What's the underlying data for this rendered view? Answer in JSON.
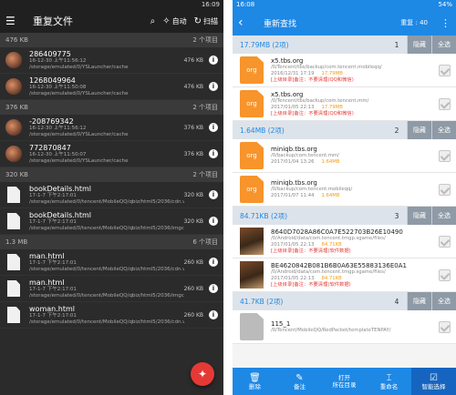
{
  "left": {
    "status_time": "16:09",
    "title": "重复文件",
    "auto_label": "自动",
    "scan_label": "扫描",
    "groups": [
      {
        "size": "476 KB",
        "count": "2 个项目",
        "items": [
          {
            "name": "286409775",
            "date": "16-12-30 上午11:56:12",
            "path": "/storage/emulated/0/YSLauncher/cache",
            "size": "476 KB",
            "kind": "image"
          },
          {
            "name": "1268049964",
            "date": "16-12-30 上午11:50:08",
            "path": "/storage/emulated/0/YSLauncher/cache",
            "size": "476 KB",
            "kind": "image"
          }
        ]
      },
      {
        "size": "376 KB",
        "count": "2 个项目",
        "items": [
          {
            "name": "-208769342",
            "date": "16-12-30 上午11:56:12",
            "path": "/storage/emulated/0/YSLauncher/cache",
            "size": "376 KB",
            "kind": "image"
          },
          {
            "name": "772870847",
            "date": "16-12-30 上午11:50:07",
            "path": "/storage/emulated/0/YSLauncher/cache",
            "size": "376 KB",
            "kind": "image"
          }
        ]
      },
      {
        "size": "320 KB",
        "count": "2 个项目",
        "items": [
          {
            "name": "bookDetails.html",
            "date": "17-1-7 下午2:17:01",
            "path": "/storage/emulated/0/tencent/MobileQQ/qbiz/html5/2036/cdn.vip.qq",
            "size": "320 KB",
            "kind": "file"
          },
          {
            "name": "bookDetails.html",
            "date": "17-1-7 下午2:17:01",
            "path": "/storage/emulated/0/tencent/MobileQQ/qbiz/html5/2036/imgcache",
            "size": "320 KB",
            "kind": "file"
          }
        ]
      },
      {
        "size": "1.3 MB",
        "count": "6 个项目",
        "items": [
          {
            "name": "man.html",
            "date": "17-1-7 下午2:17:01",
            "path": "/storage/emulated/0/tencent/MobileQQ/qbiz/html5/2036/cdn.vip.qq",
            "size": "260 KB",
            "kind": "file"
          },
          {
            "name": "man.html",
            "date": "17-1-7 下午2:17:01",
            "path": "/storage/emulated/0/tencent/MobileQQ/qbiz/html5/2036/imgcache",
            "size": "260 KB",
            "kind": "file"
          },
          {
            "name": "woman.html",
            "date": "17-1-7 下午2:17:01",
            "path": "/storage/emulated/0/tencent/MobileQQ/qbiz/html5/2036/cdn.vip.qq",
            "size": "260 KB",
            "kind": "file"
          }
        ]
      }
    ]
  },
  "right": {
    "status_time": "16:08",
    "status_battery": "54%",
    "title": "重新查找",
    "repeat_label": "重复 : 40",
    "groups": [
      {
        "size": "17.79MB",
        "count": "(2项)",
        "index": "1",
        "hide": "隐藏",
        "select_all": "全选",
        "items": [
          {
            "name": "x5.tbs.org",
            "path": "/0/Tencent/tbs/backup/com.tencent.mobileqq/",
            "date": "2016/12/31 17:19",
            "size": "17.79MB",
            "note": "[上级目录]备注：不要清理(QQ和微信)",
            "kind": "org"
          },
          {
            "name": "x5.tbs.org",
            "path": "/0/Tencent/tbs/backup/com.tencent.mm/",
            "date": "2017/01/05 22:13",
            "size": "17.79MB",
            "note": "[上级目录]备注：不要清理(QQ和微信)",
            "kind": "org"
          }
        ]
      },
      {
        "size": "1.64MB",
        "count": "(2项)",
        "index": "2",
        "hide": "隐藏",
        "select_all": "全选",
        "items": [
          {
            "name": "miniqb.tbs.org",
            "path": "/0/backup/com.tencent.mm/",
            "date": "2017/01/04 13:26",
            "size": "1.64MB",
            "note": "",
            "kind": "org"
          },
          {
            "name": "miniqb.tbs.org",
            "path": "/0/backup/com.tencent.mobileqq/",
            "date": "2017/01/07 11:44",
            "size": "1.64MB",
            "note": "",
            "kind": "org"
          }
        ]
      },
      {
        "size": "84.71KB",
        "count": "(2项)",
        "index": "3",
        "hide": "隐藏",
        "select_all": "全选",
        "items": [
          {
            "name": "8640D7028A86C0A7E522703B26E10490",
            "path": "/0/Android/data/com.tencent.tmgp.sgame/files/",
            "date": "2017/01/05 22:13",
            "size": "84.71KB",
            "note": "[上级目录]备注：不要清理(软件数据)",
            "kind": "img"
          },
          {
            "name": "BE4620842B081B6B0A63E55883136E0A1",
            "path": "/0/Android/data/com.tencent.tmgp.sgame/files/",
            "date": "2017/01/05 22:13",
            "size": "84.71KB",
            "note": "[上级目录]备注：不要清理(软件数据)",
            "kind": "img"
          }
        ]
      },
      {
        "size": "41.7KB",
        "count": "(2项)",
        "index": "4",
        "hide": "隐藏",
        "select_all": "全选",
        "items": [
          {
            "name": "115_1",
            "path": "/0/Tencent/MobileQQ/RedPacket/templateTENPAY/",
            "date": "",
            "size": "",
            "note": "",
            "kind": "file"
          }
        ]
      }
    ],
    "bottom": [
      {
        "icon": "trash-icon",
        "label1": "删除",
        "label2": ""
      },
      {
        "icon": "edit-icon",
        "label1": "备注",
        "label2": ""
      },
      {
        "icon": "folder-icon",
        "label1": "打开",
        "label2": "所在目录"
      },
      {
        "icon": "rename-icon",
        "label1": "重命名",
        "label2": ""
      },
      {
        "icon": "select-icon",
        "label1": "智能选择",
        "label2": ""
      }
    ]
  }
}
